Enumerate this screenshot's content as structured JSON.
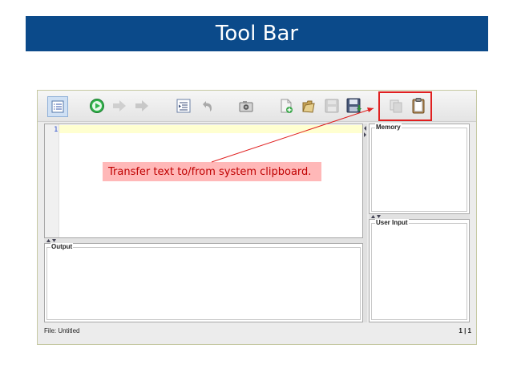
{
  "slide": {
    "title": "Tool Bar"
  },
  "callout": {
    "text": "Transfer text to/from system clipboard."
  },
  "panels": {
    "memory_label": "Memory",
    "user_input_label": "User Input",
    "output_label": "Output"
  },
  "editor": {
    "line_numbers": [
      "1"
    ]
  },
  "status": {
    "file": "File: Untitled",
    "position": "1 | 1"
  },
  "toolbar": {
    "buttons": [
      "toggle-line-numbers",
      "run",
      "step",
      "step-over",
      "indent",
      "undo",
      "screenshot",
      "new-file",
      "open-file",
      "save-disabled",
      "save",
      "copy",
      "paste"
    ]
  },
  "colors": {
    "title_bg": "#0b4a8a",
    "highlight": "#e02020",
    "callout_bg": "#ffb8b8",
    "callout_text": "#c00000",
    "run_green": "#2fb34a"
  }
}
